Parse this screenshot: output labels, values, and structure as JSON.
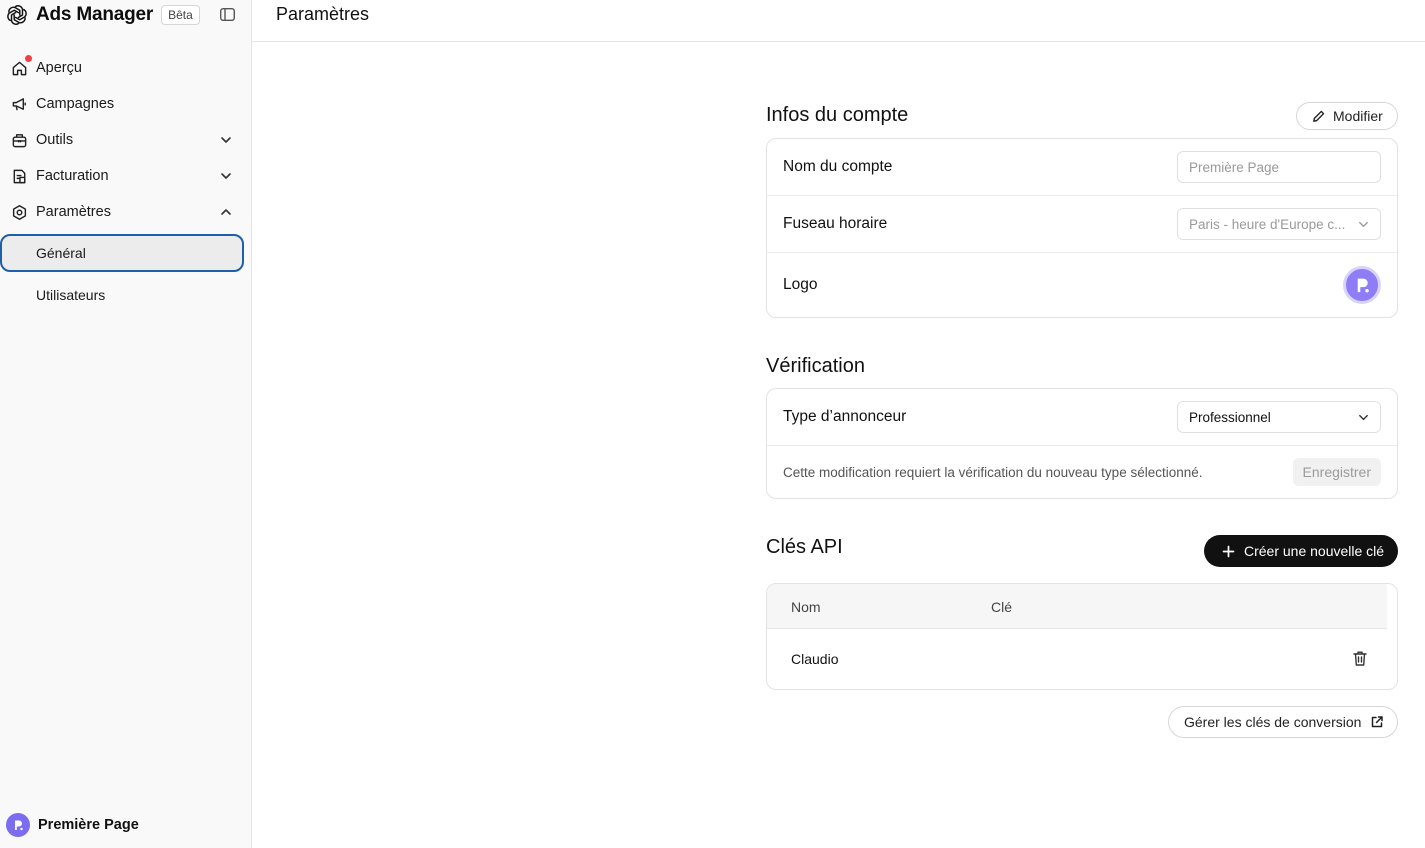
{
  "app": {
    "brand_name": "Ads Manager",
    "beta_label": "Bêta",
    "notification_color": "#ef4146"
  },
  "sidebar": {
    "items": [
      {
        "label": "Aperçu",
        "icon": "home-icon",
        "notification": true
      },
      {
        "label": "Campagnes",
        "icon": "megaphone-icon"
      },
      {
        "label": "Outils",
        "icon": "toolbox-icon",
        "expanded": false
      },
      {
        "label": "Facturation",
        "icon": "receipt-icon",
        "expanded": false
      },
      {
        "label": "Paramètres",
        "icon": "gear-icon",
        "expanded": true
      }
    ],
    "sub_items": [
      {
        "label": "Général",
        "active": true
      },
      {
        "label": "Utilisateurs",
        "active": false
      }
    ],
    "footer": {
      "account_name": "Première Page"
    }
  },
  "header": {
    "title": "Paramètres"
  },
  "account_info": {
    "title": "Infos du compte",
    "edit_label": "Modifier",
    "account_name_label": "Nom du compte",
    "account_name_placeholder": "Première Page",
    "timezone_label": "Fuseau horaire",
    "timezone_value": "Paris - heure d'Europe c...",
    "logo_label": "Logo"
  },
  "verification": {
    "title": "Vérification",
    "advertiser_type_label": "Type d’annonceur",
    "advertiser_type_value": "Professionnel",
    "note": "Cette modification requiert la vérification du nouveau type sélectionné.",
    "save_label": "Enregistrer"
  },
  "api_keys": {
    "title": "Clés API",
    "create_label": "Créer une nouvelle clé",
    "columns": [
      "Nom",
      "Clé"
    ],
    "rows": [
      {
        "name": "Claudio",
        "key": ""
      }
    ],
    "manage_label": "Gérer les clés de conversion"
  },
  "colors": {
    "accent_focus": "#1d5fa8",
    "logo_purple": "#8f7cf7",
    "primary_button": "#111111"
  }
}
